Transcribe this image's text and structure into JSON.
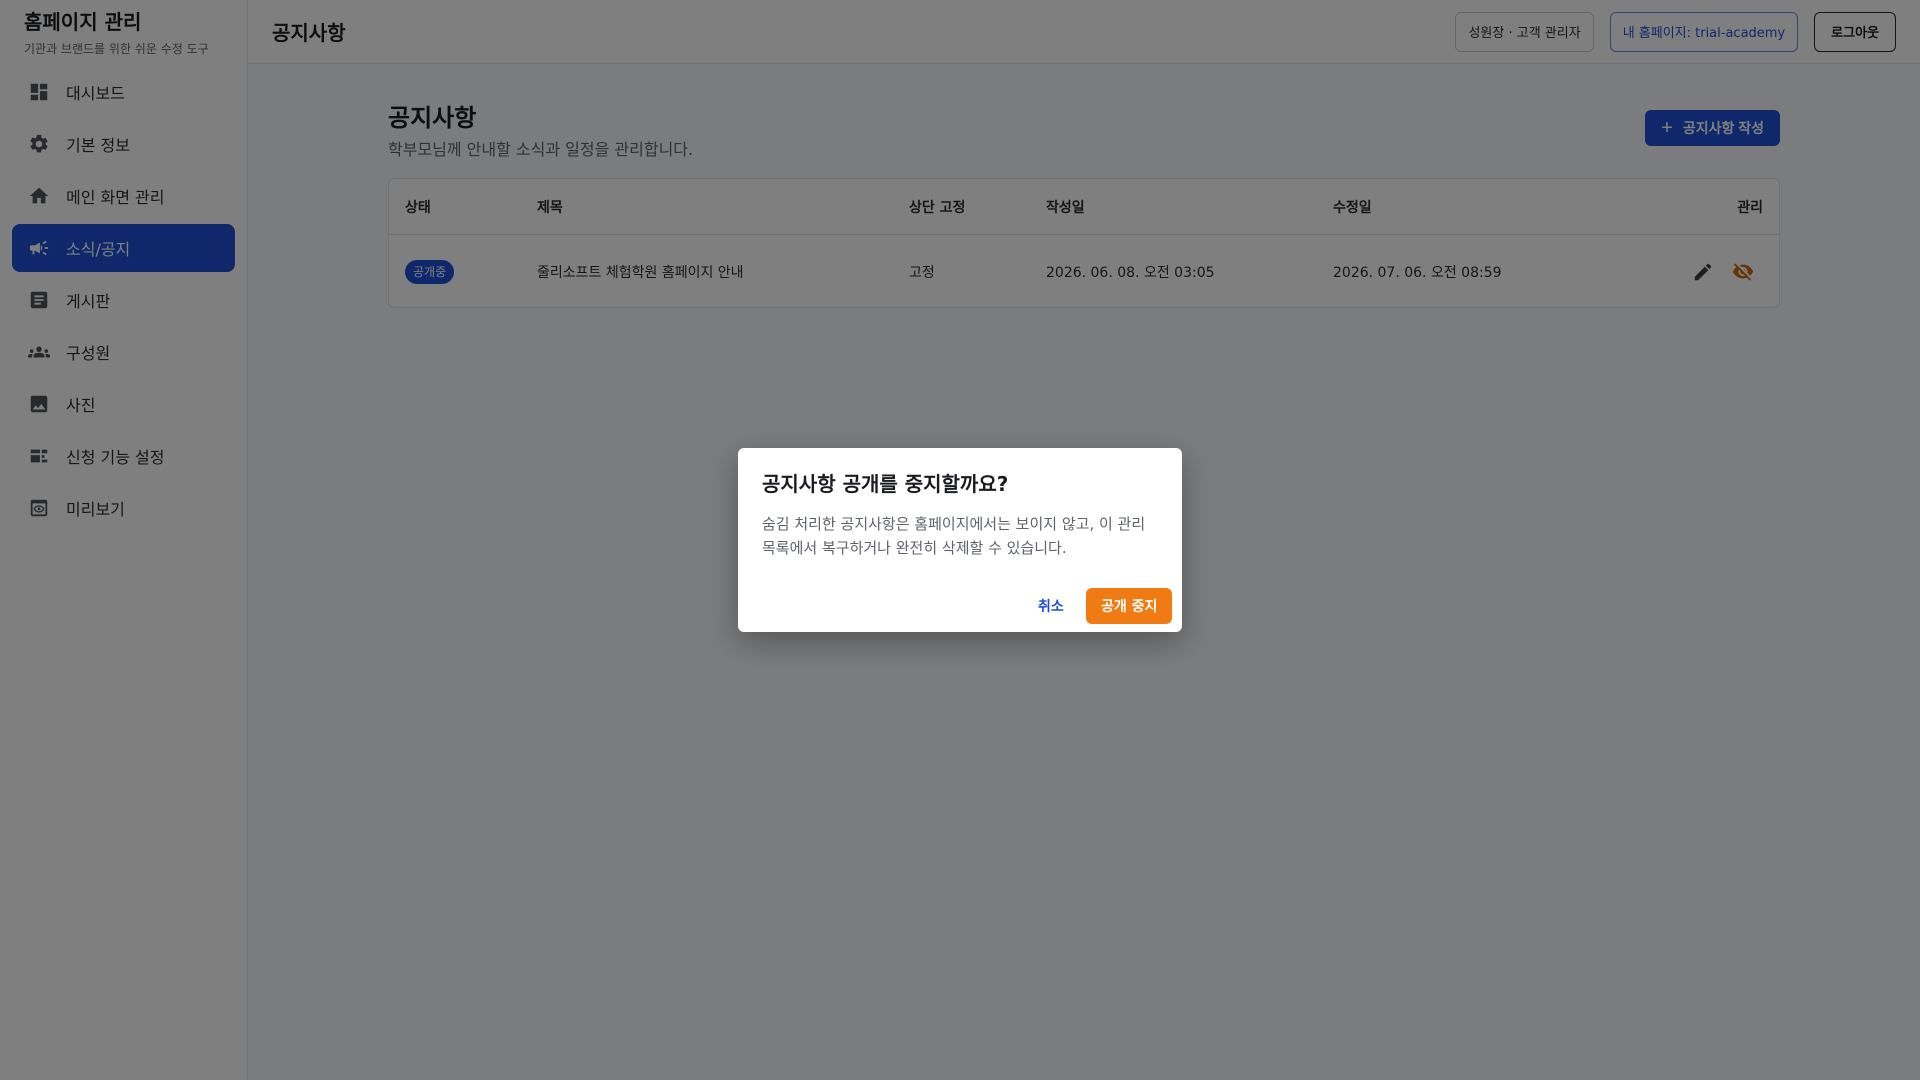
{
  "brand": {
    "title": "홈페이지 관리",
    "subtitle": "기관과 브랜드를 위한 쉬운 수정 도구"
  },
  "sidebar": {
    "items": [
      {
        "label": "대시보드",
        "icon": "dashboard-icon"
      },
      {
        "label": "기본 정보",
        "icon": "gear-icon"
      },
      {
        "label": "메인 화면 관리",
        "icon": "home-icon"
      },
      {
        "label": "소식/공지",
        "icon": "megaphone-icon",
        "active": true
      },
      {
        "label": "게시판",
        "icon": "article-icon"
      },
      {
        "label": "구성원",
        "icon": "people-icon"
      },
      {
        "label": "사진",
        "icon": "image-icon"
      },
      {
        "label": "신청 기능 설정",
        "icon": "form-icon"
      },
      {
        "label": "미리보기",
        "icon": "preview-icon"
      }
    ]
  },
  "header": {
    "title": "공지사항",
    "user_label": "성원장 · 고객 관리자",
    "site_label": "내 홈페이지: trial-academy",
    "logout_label": "로그아웃"
  },
  "main": {
    "title": "공지사항",
    "subtitle": "학부모님께 안내할 소식과 일정을 관리합니다.",
    "create_button": "공지사항 작성",
    "table": {
      "columns": [
        "상태",
        "제목",
        "상단 고정",
        "작성일",
        "수정일",
        "관리"
      ],
      "rows": [
        {
          "status": "공개중",
          "title": "줄리소프트 체험학원 홈페이지 안내",
          "pinned": "고정",
          "created": "2026. 06. 08. 오전 03:05",
          "updated": "2026. 07. 06. 오전 08:59"
        }
      ]
    }
  },
  "dialog": {
    "title": "공지사항 공개를 중지할까요?",
    "body": "숨김 처리한 공지사항은 홈페이지에서는 보이지 않고, 이 관리 목록에서 복구하거나 완전히 삭제할 수 있습니다.",
    "cancel_label": "취소",
    "confirm_label": "공개 중지"
  },
  "colors": {
    "primary": "#1f4fd6",
    "warning": "#f07b12",
    "overlay": "rgba(0,0,0,0.5)"
  }
}
